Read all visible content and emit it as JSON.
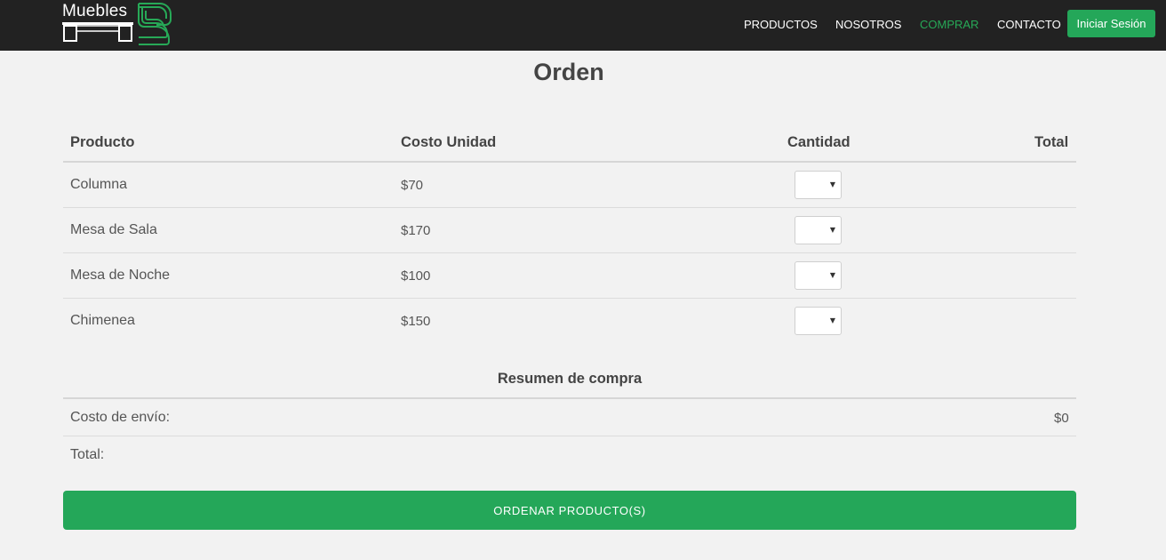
{
  "nav": {
    "brand": "Muebles",
    "links": [
      "PRODUCTOS",
      "NOSOTROS",
      "COMPRAR",
      "CONTACTO"
    ],
    "active": "COMPRAR",
    "login": "Iniciar Sesión"
  },
  "colors": {
    "navbar": "#222222",
    "accent": "#24a759",
    "background": "#f2f2f2"
  },
  "page": {
    "title": "Orden"
  },
  "table": {
    "headers": [
      "Producto",
      "Costo Unidad",
      "Cantidad",
      "Total"
    ],
    "rows": [
      {
        "product": "Columna",
        "unit_cost": "$70"
      },
      {
        "product": "Mesa de Sala",
        "unit_cost": "$170"
      },
      {
        "product": "Mesa de Noche",
        "unit_cost": "$100"
      },
      {
        "product": "Chimenea",
        "unit_cost": "$150"
      }
    ]
  },
  "summary": {
    "title": "Resumen de compra",
    "shipping_label": "Costo de envío:",
    "shipping_value": "$0",
    "total_label": "Total:"
  },
  "order_button": "ORDENAR PRODUCTO(S)"
}
